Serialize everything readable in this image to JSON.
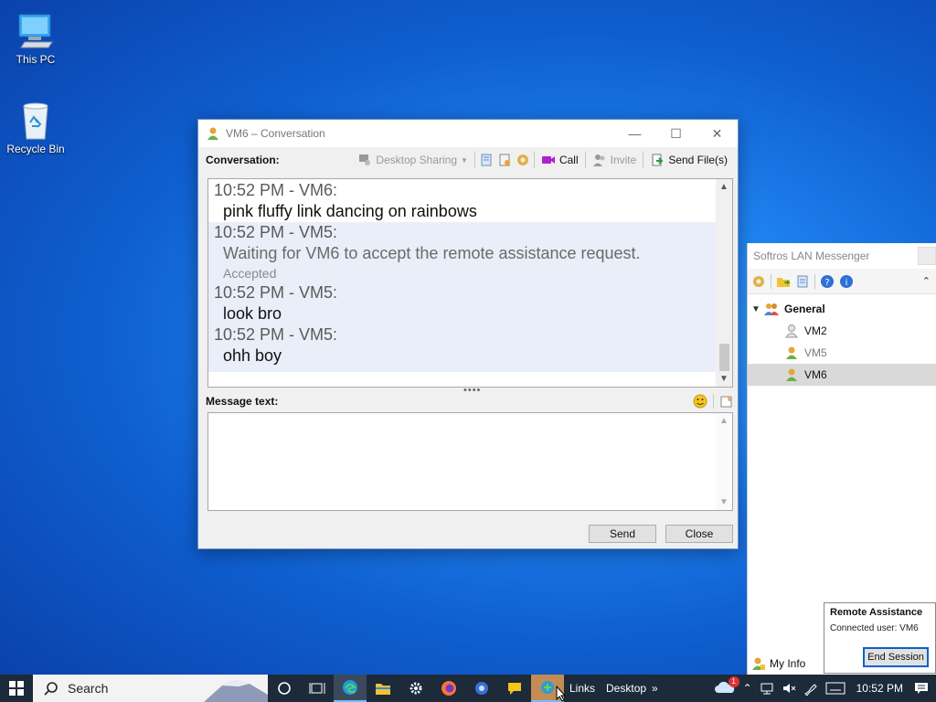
{
  "desktop": {
    "icons": [
      {
        "label": "This PC",
        "icon": "computer-icon"
      },
      {
        "label": "Recycle Bin",
        "icon": "recycle-bin-icon"
      }
    ]
  },
  "conversation_window": {
    "title": "VM6 – Conversation",
    "conversation_label": "Conversation:",
    "toolbar": {
      "desktop_sharing": "Desktop Sharing",
      "call": "Call",
      "invite": "Invite",
      "send_files": "Send File(s)"
    },
    "messages": [
      {
        "header": "10:52 PM - VM6:",
        "text": "pink fluffy link dancing on rainbows",
        "alt": false
      },
      {
        "header": "10:52 PM - VM5:",
        "text": "Waiting for VM6 to accept the remote assistance request.",
        "status": "Accepted",
        "alt": true
      },
      {
        "header": "10:52 PM - VM5:",
        "text": "look bro",
        "alt": true
      },
      {
        "header": "10:52 PM - VM5:",
        "text": "ohh boy",
        "alt": true
      }
    ],
    "message_text_label": "Message text:",
    "message_text_value": "",
    "send_label": "Send",
    "close_label": "Close"
  },
  "lan_messenger": {
    "title": "Softros LAN Messenger",
    "group": "General",
    "users": [
      {
        "name": "VM2",
        "status": "offline"
      },
      {
        "name": "VM5",
        "status": "online"
      },
      {
        "name": "VM6",
        "status": "online",
        "selected": true
      }
    ],
    "my_info": "My Info"
  },
  "remote_assistance": {
    "title": "Remote Assistance",
    "connected": "Connected user: VM6",
    "end_session": "End Session"
  },
  "taskbar": {
    "search_placeholder": "Search",
    "links": "Links",
    "desktop": "Desktop",
    "notification_count": "1",
    "time": "10:52 PM"
  },
  "colors": {
    "accent": "#0a63c9",
    "taskbar": "#1c2a3a",
    "alt_row": "#e9eef8"
  }
}
